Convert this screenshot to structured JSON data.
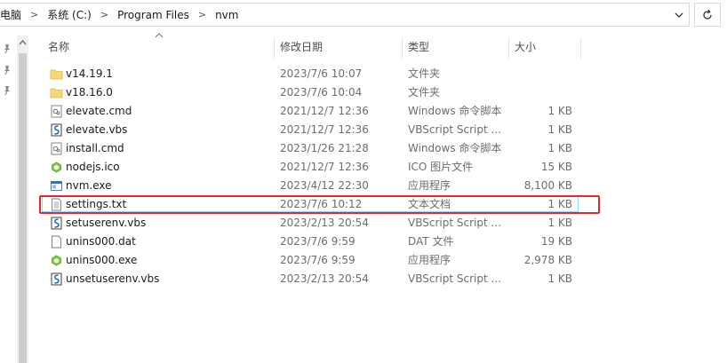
{
  "breadcrumb": {
    "items": [
      "此电脑",
      "系统 (C:)",
      "Program Files",
      "nvm"
    ]
  },
  "columns": {
    "name": "名称",
    "date": "修改日期",
    "type": "类型",
    "size": "大小"
  },
  "files": [
    {
      "name": "v14.19.1",
      "date": "2023/7/6 10:07",
      "type": "文件夹",
      "size": "",
      "icon": "folder-icon"
    },
    {
      "name": "v18.16.0",
      "date": "2023/7/6 10:04",
      "type": "文件夹",
      "size": "",
      "icon": "folder-icon"
    },
    {
      "name": "elevate.cmd",
      "date": "2021/12/7 12:36",
      "type": "Windows 命令脚本",
      "size": "1 KB",
      "icon": "cmd-script-icon"
    },
    {
      "name": "elevate.vbs",
      "date": "2021/12/7 12:36",
      "type": "VBScript Script ...",
      "size": "1 KB",
      "icon": "vbs-script-icon"
    },
    {
      "name": "install.cmd",
      "date": "2023/1/26 21:28",
      "type": "Windows 命令脚本",
      "size": "1 KB",
      "icon": "cmd-script-icon"
    },
    {
      "name": "nodejs.ico",
      "date": "2021/12/7 12:36",
      "type": "ICO 图片文件",
      "size": "15 KB",
      "icon": "nodejs-ico-icon"
    },
    {
      "name": "nvm.exe",
      "date": "2023/4/12 22:30",
      "type": "应用程序",
      "size": "8,100 KB",
      "icon": "exe-icon"
    },
    {
      "name": "settings.txt",
      "date": "2023/7/6 10:12",
      "type": "文本文档",
      "size": "1 KB",
      "icon": "text-file-icon"
    },
    {
      "name": "setuserenv.vbs",
      "date": "2023/2/13 20:54",
      "type": "VBScript Script ...",
      "size": "1 KB",
      "icon": "vbs-script-icon"
    },
    {
      "name": "unins000.dat",
      "date": "2023/7/6 9:59",
      "type": "DAT 文件",
      "size": "19 KB",
      "icon": "dat-file-icon"
    },
    {
      "name": "unins000.exe",
      "date": "2023/7/6 9:59",
      "type": "应用程序",
      "size": "2,978 KB",
      "icon": "installer-icon"
    },
    {
      "name": "unsetuserenv.vbs",
      "date": "2023/2/13 20:54",
      "type": "VBScript Script ...",
      "size": "1 KB",
      "icon": "vbs-script-icon"
    }
  ],
  "selected_file": "settings.txt",
  "colors": {
    "highlight_frame": "#e8262b",
    "selection_border": "#99d1ff",
    "folder": "#f8d775"
  }
}
